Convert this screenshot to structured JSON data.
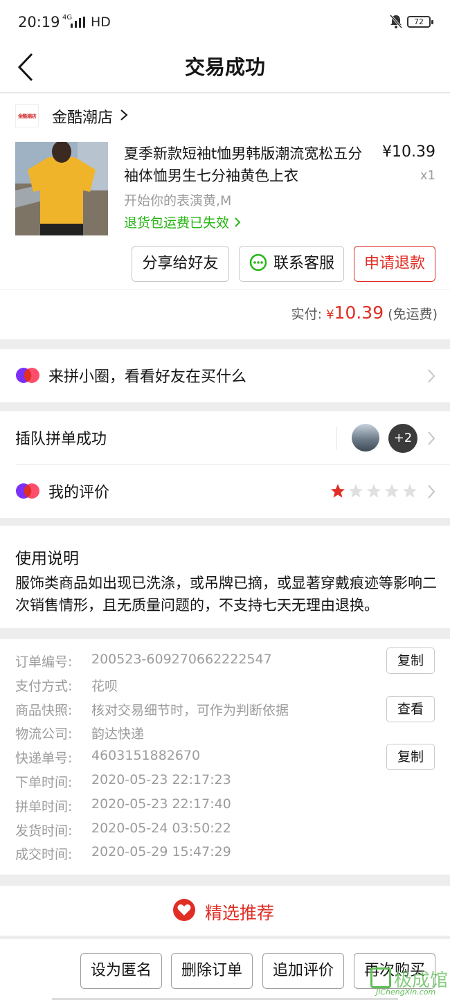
{
  "status_bar": {
    "time": "20:19",
    "network": "4G",
    "hd": "HD",
    "battery": "72"
  },
  "nav": {
    "title": "交易成功"
  },
  "shop": {
    "logo_text": "金酷潮店",
    "name": "金酷潮店"
  },
  "product": {
    "title": "夏季新款短袖t恤男韩版潮流宽松五分袖体恤男生七分袖黄色上衣",
    "price": "¥10.39",
    "qty": "x1",
    "sku": "开始你的表演黄,M",
    "return_note": "退货包运费已失效"
  },
  "actions": {
    "share": "分享给好友",
    "service": "联系客服",
    "refund": "申请退款"
  },
  "payment": {
    "label": "实付:",
    "yen": "¥",
    "amount": "10.39",
    "note": "(免运费)"
  },
  "circle": {
    "label": "来拼小圈，看看好友在买什么"
  },
  "group": {
    "label": "插队拼单成功",
    "more": "+2"
  },
  "review": {
    "label": "我的评价",
    "rating": 1,
    "max": 5
  },
  "usage": {
    "title": "使用说明",
    "text": "服饰类商品如出现已洗涤，或吊牌已摘，或显著穿戴痕迹等影响二次销售情形，且无质量问题的，不支持七天无理由退换。"
  },
  "order_info": [
    {
      "key": "订单编号:",
      "value": "200523-609270662222547",
      "button": "复制"
    },
    {
      "key": "支付方式:",
      "value": "花呗"
    },
    {
      "key": "商品快照:",
      "value": "核对交易细节时，可作为判断依据",
      "button": "查看"
    },
    {
      "key": "物流公司:",
      "value": "韵达快递"
    },
    {
      "key": "快递单号:",
      "value": "4603151882670",
      "button": "复制"
    },
    {
      "key": "下单时间:",
      "value": "2020-05-23 22:17:23"
    },
    {
      "key": "拼单时间:",
      "value": "2020-05-23 22:17:40"
    },
    {
      "key": "发货时间:",
      "value": "2020-05-24 03:50:22"
    },
    {
      "key": "成交时间:",
      "value": "2020-05-29 15:47:29"
    }
  ],
  "recommend": {
    "label": "精选推荐"
  },
  "bottom": {
    "anonymous": "设为匿名",
    "delete": "删除订单",
    "add_review": "追加评价",
    "rebuy": "再次购买"
  },
  "watermark": {
    "title": "极成馆",
    "site": "JiChengXin.com"
  },
  "colors": {
    "accent": "#e02e24",
    "green": "#25b513",
    "star_on": "#e02e24",
    "star_off": "#e0e0e0"
  }
}
